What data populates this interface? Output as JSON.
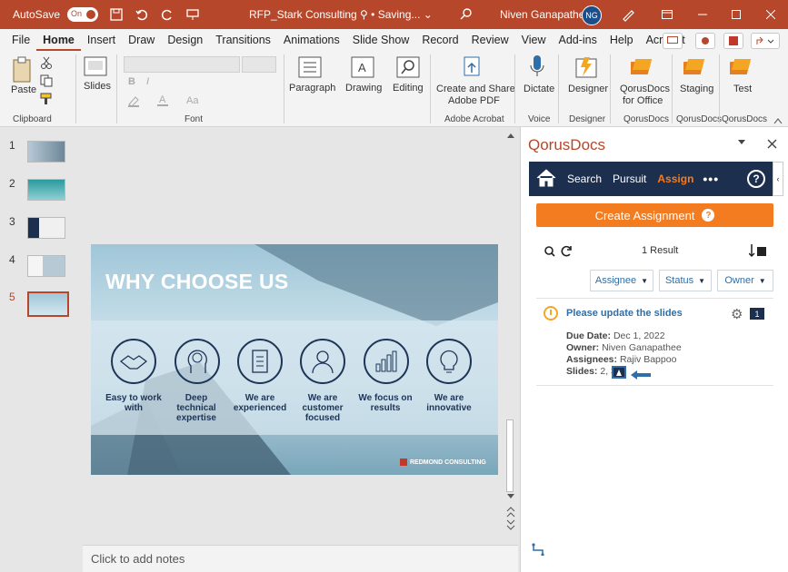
{
  "titlebar": {
    "autosave": "AutoSave",
    "toggle": "On",
    "doc_title": "RFP_Stark Consulting  ⚲ • Saving... ⌄",
    "user": "Niven Ganapathee",
    "initials": "NG"
  },
  "menu": [
    "File",
    "Home",
    "Insert",
    "Draw",
    "Design",
    "Transitions",
    "Animations",
    "Slide Show",
    "Record",
    "Review",
    "View",
    "Add-ins",
    "Help",
    "Acrobat"
  ],
  "ribbon": {
    "paste": "Paste",
    "clipboard": "Clipboard",
    "slides": "Slides",
    "font": "Font",
    "paragraph": "Paragraph",
    "drawing": "Drawing",
    "editing": "Editing",
    "create_share_1": "Create and Share",
    "create_share_2": "Adobe PDF",
    "adobe_acrobat": "Adobe Acrobat",
    "dictate": "Dictate",
    "voice": "Voice",
    "designer": "Designer",
    "designer_group": "Designer",
    "qorus_office_1": "QorusDocs",
    "qorus_office_2": "for Office",
    "qorus_group1": "QorusDocs",
    "staging": "Staging",
    "qorus_group2": "QorusDocs",
    "test": "Test",
    "qorus_group3": "QorusDocs",
    "bold": "B",
    "italic": "I",
    "font_size": "Aa"
  },
  "thumbnails": [
    "1",
    "2",
    "3",
    "4",
    "5"
  ],
  "slide": {
    "title": "WHY CHOOSE US",
    "items": [
      "Easy to work with",
      "Deep technical expertise",
      "We are experienced",
      "We are customer focused",
      "We focus on results",
      "We are innovative"
    ],
    "logo": "REDMOND CONSULTING"
  },
  "notes": "Click to add notes",
  "pane": {
    "title": "QorusDocs",
    "nav": {
      "search": "Search",
      "pursuit": "Pursuit",
      "assign": "Assign",
      "more": "•••",
      "help": "?"
    },
    "create_button": "Create Assignment",
    "result_count": "1 Result",
    "filters": [
      "Assignee",
      "Status",
      "Owner"
    ],
    "card": {
      "title": "Please update the slides",
      "badge": "1",
      "due_label": "Due Date:",
      "due_value": "Dec 1, 2022",
      "owner_label": "Owner:",
      "owner_value": "Niven Ganapathee",
      "assignees_label": "Assignees:",
      "assignees_value": "Rajiv Bappoo",
      "slides_label": "Slides:",
      "slides_value": "2, 3"
    }
  },
  "colors": {
    "accent": "#b7472a",
    "navy": "#1c2f4e",
    "orange": "#f47c20",
    "link": "#2f6ea8"
  }
}
